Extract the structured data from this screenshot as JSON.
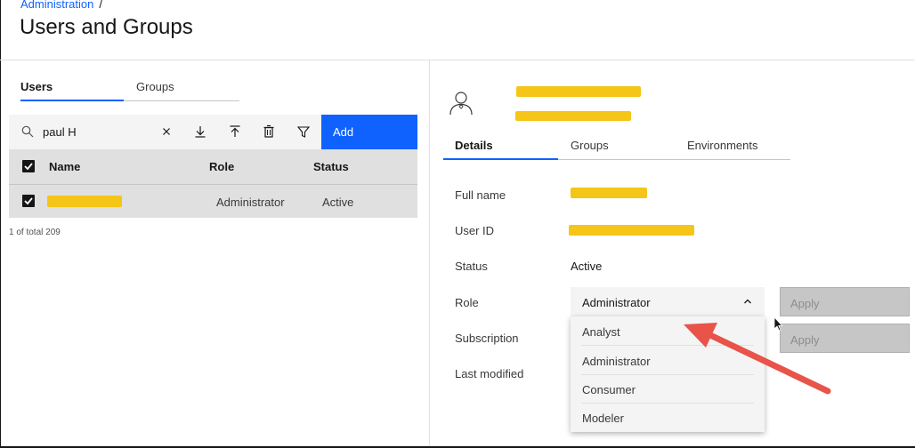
{
  "breadcrumb": {
    "parent": "Administration",
    "separator": "/"
  },
  "page": {
    "title": "Users and Groups"
  },
  "left_tabs": [
    {
      "label": "Users",
      "active": true
    },
    {
      "label": "Groups",
      "active": false
    }
  ],
  "toolbar": {
    "search_value": "paul H",
    "icons": [
      "search-icon",
      "clear-icon",
      "download-icon",
      "upload-icon",
      "delete-icon",
      "filter-icon"
    ],
    "add_label": "Add"
  },
  "table": {
    "columns": [
      "Name",
      "Role",
      "Status"
    ],
    "rows": [
      {
        "name": "",
        "role": "Administrator",
        "status": "Active",
        "selected": true
      }
    ],
    "total_text": "1 of total 209"
  },
  "detail": {
    "tabs": [
      {
        "label": "Details",
        "active": true
      },
      {
        "label": "Groups",
        "active": false
      },
      {
        "label": "Environments",
        "active": false
      }
    ],
    "fields": {
      "full_name_label": "Full name",
      "user_id_label": "User ID",
      "status_label": "Status",
      "status_value": "Active",
      "role_label": "Role",
      "role_value": "Administrator",
      "subscription_label": "Subscription",
      "last_modified_label": "Last modified"
    },
    "apply_label": "Apply",
    "role_options": [
      "Analyst",
      "Administrator",
      "Consumer",
      "Modeler"
    ]
  },
  "colors": {
    "accent": "#0f62fe",
    "redaction": "#f5c518",
    "arrow": "#e8534a"
  }
}
